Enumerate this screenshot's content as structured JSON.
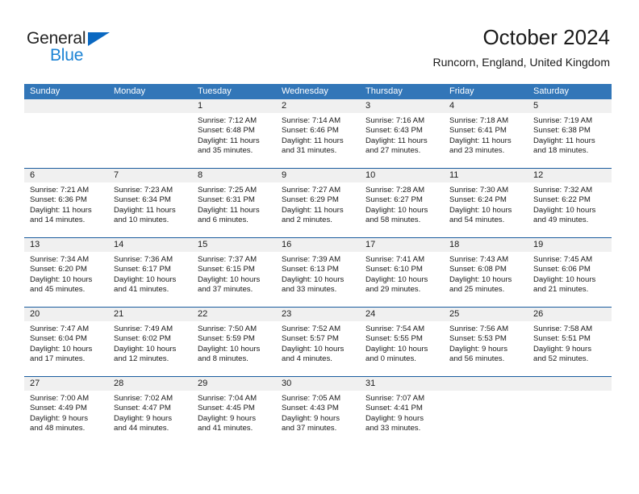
{
  "brand": {
    "name_top": "General",
    "name_bottom": "Blue",
    "triangle_color": "#0a68c1",
    "blue_text_color": "#1c83d4"
  },
  "header": {
    "title": "October 2024",
    "subtitle": "Runcorn, England, United Kingdom"
  },
  "colors": {
    "header_blue": "#3276b8",
    "separator_blue": "#1a5c9e",
    "daynum_band": "#f0f0f0",
    "text": "#1a1a1a"
  },
  "weekdays": [
    "Sunday",
    "Monday",
    "Tuesday",
    "Wednesday",
    "Thursday",
    "Friday",
    "Saturday"
  ],
  "weeks": [
    [
      {
        "day": "",
        "sunrise": "",
        "sunset": "",
        "daylight_1": "",
        "daylight_2": ""
      },
      {
        "day": "",
        "sunrise": "",
        "sunset": "",
        "daylight_1": "",
        "daylight_2": ""
      },
      {
        "day": "1",
        "sunrise": "Sunrise: 7:12 AM",
        "sunset": "Sunset: 6:48 PM",
        "daylight_1": "Daylight: 11 hours",
        "daylight_2": "and 35 minutes."
      },
      {
        "day": "2",
        "sunrise": "Sunrise: 7:14 AM",
        "sunset": "Sunset: 6:46 PM",
        "daylight_1": "Daylight: 11 hours",
        "daylight_2": "and 31 minutes."
      },
      {
        "day": "3",
        "sunrise": "Sunrise: 7:16 AM",
        "sunset": "Sunset: 6:43 PM",
        "daylight_1": "Daylight: 11 hours",
        "daylight_2": "and 27 minutes."
      },
      {
        "day": "4",
        "sunrise": "Sunrise: 7:18 AM",
        "sunset": "Sunset: 6:41 PM",
        "daylight_1": "Daylight: 11 hours",
        "daylight_2": "and 23 minutes."
      },
      {
        "day": "5",
        "sunrise": "Sunrise: 7:19 AM",
        "sunset": "Sunset: 6:38 PM",
        "daylight_1": "Daylight: 11 hours",
        "daylight_2": "and 18 minutes."
      }
    ],
    [
      {
        "day": "6",
        "sunrise": "Sunrise: 7:21 AM",
        "sunset": "Sunset: 6:36 PM",
        "daylight_1": "Daylight: 11 hours",
        "daylight_2": "and 14 minutes."
      },
      {
        "day": "7",
        "sunrise": "Sunrise: 7:23 AM",
        "sunset": "Sunset: 6:34 PM",
        "daylight_1": "Daylight: 11 hours",
        "daylight_2": "and 10 minutes."
      },
      {
        "day": "8",
        "sunrise": "Sunrise: 7:25 AM",
        "sunset": "Sunset: 6:31 PM",
        "daylight_1": "Daylight: 11 hours",
        "daylight_2": "and 6 minutes."
      },
      {
        "day": "9",
        "sunrise": "Sunrise: 7:27 AM",
        "sunset": "Sunset: 6:29 PM",
        "daylight_1": "Daylight: 11 hours",
        "daylight_2": "and 2 minutes."
      },
      {
        "day": "10",
        "sunrise": "Sunrise: 7:28 AM",
        "sunset": "Sunset: 6:27 PM",
        "daylight_1": "Daylight: 10 hours",
        "daylight_2": "and 58 minutes."
      },
      {
        "day": "11",
        "sunrise": "Sunrise: 7:30 AM",
        "sunset": "Sunset: 6:24 PM",
        "daylight_1": "Daylight: 10 hours",
        "daylight_2": "and 54 minutes."
      },
      {
        "day": "12",
        "sunrise": "Sunrise: 7:32 AM",
        "sunset": "Sunset: 6:22 PM",
        "daylight_1": "Daylight: 10 hours",
        "daylight_2": "and 49 minutes."
      }
    ],
    [
      {
        "day": "13",
        "sunrise": "Sunrise: 7:34 AM",
        "sunset": "Sunset: 6:20 PM",
        "daylight_1": "Daylight: 10 hours",
        "daylight_2": "and 45 minutes."
      },
      {
        "day": "14",
        "sunrise": "Sunrise: 7:36 AM",
        "sunset": "Sunset: 6:17 PM",
        "daylight_1": "Daylight: 10 hours",
        "daylight_2": "and 41 minutes."
      },
      {
        "day": "15",
        "sunrise": "Sunrise: 7:37 AM",
        "sunset": "Sunset: 6:15 PM",
        "daylight_1": "Daylight: 10 hours",
        "daylight_2": "and 37 minutes."
      },
      {
        "day": "16",
        "sunrise": "Sunrise: 7:39 AM",
        "sunset": "Sunset: 6:13 PM",
        "daylight_1": "Daylight: 10 hours",
        "daylight_2": "and 33 minutes."
      },
      {
        "day": "17",
        "sunrise": "Sunrise: 7:41 AM",
        "sunset": "Sunset: 6:10 PM",
        "daylight_1": "Daylight: 10 hours",
        "daylight_2": "and 29 minutes."
      },
      {
        "day": "18",
        "sunrise": "Sunrise: 7:43 AM",
        "sunset": "Sunset: 6:08 PM",
        "daylight_1": "Daylight: 10 hours",
        "daylight_2": "and 25 minutes."
      },
      {
        "day": "19",
        "sunrise": "Sunrise: 7:45 AM",
        "sunset": "Sunset: 6:06 PM",
        "daylight_1": "Daylight: 10 hours",
        "daylight_2": "and 21 minutes."
      }
    ],
    [
      {
        "day": "20",
        "sunrise": "Sunrise: 7:47 AM",
        "sunset": "Sunset: 6:04 PM",
        "daylight_1": "Daylight: 10 hours",
        "daylight_2": "and 17 minutes."
      },
      {
        "day": "21",
        "sunrise": "Sunrise: 7:49 AM",
        "sunset": "Sunset: 6:02 PM",
        "daylight_1": "Daylight: 10 hours",
        "daylight_2": "and 12 minutes."
      },
      {
        "day": "22",
        "sunrise": "Sunrise: 7:50 AM",
        "sunset": "Sunset: 5:59 PM",
        "daylight_1": "Daylight: 10 hours",
        "daylight_2": "and 8 minutes."
      },
      {
        "day": "23",
        "sunrise": "Sunrise: 7:52 AM",
        "sunset": "Sunset: 5:57 PM",
        "daylight_1": "Daylight: 10 hours",
        "daylight_2": "and 4 minutes."
      },
      {
        "day": "24",
        "sunrise": "Sunrise: 7:54 AM",
        "sunset": "Sunset: 5:55 PM",
        "daylight_1": "Daylight: 10 hours",
        "daylight_2": "and 0 minutes."
      },
      {
        "day": "25",
        "sunrise": "Sunrise: 7:56 AM",
        "sunset": "Sunset: 5:53 PM",
        "daylight_1": "Daylight: 9 hours",
        "daylight_2": "and 56 minutes."
      },
      {
        "day": "26",
        "sunrise": "Sunrise: 7:58 AM",
        "sunset": "Sunset: 5:51 PM",
        "daylight_1": "Daylight: 9 hours",
        "daylight_2": "and 52 minutes."
      }
    ],
    [
      {
        "day": "27",
        "sunrise": "Sunrise: 7:00 AM",
        "sunset": "Sunset: 4:49 PM",
        "daylight_1": "Daylight: 9 hours",
        "daylight_2": "and 48 minutes."
      },
      {
        "day": "28",
        "sunrise": "Sunrise: 7:02 AM",
        "sunset": "Sunset: 4:47 PM",
        "daylight_1": "Daylight: 9 hours",
        "daylight_2": "and 44 minutes."
      },
      {
        "day": "29",
        "sunrise": "Sunrise: 7:04 AM",
        "sunset": "Sunset: 4:45 PM",
        "daylight_1": "Daylight: 9 hours",
        "daylight_2": "and 41 minutes."
      },
      {
        "day": "30",
        "sunrise": "Sunrise: 7:05 AM",
        "sunset": "Sunset: 4:43 PM",
        "daylight_1": "Daylight: 9 hours",
        "daylight_2": "and 37 minutes."
      },
      {
        "day": "31",
        "sunrise": "Sunrise: 7:07 AM",
        "sunset": "Sunset: 4:41 PM",
        "daylight_1": "Daylight: 9 hours",
        "daylight_2": "and 33 minutes."
      },
      {
        "day": "",
        "sunrise": "",
        "sunset": "",
        "daylight_1": "",
        "daylight_2": ""
      },
      {
        "day": "",
        "sunrise": "",
        "sunset": "",
        "daylight_1": "",
        "daylight_2": ""
      }
    ]
  ]
}
